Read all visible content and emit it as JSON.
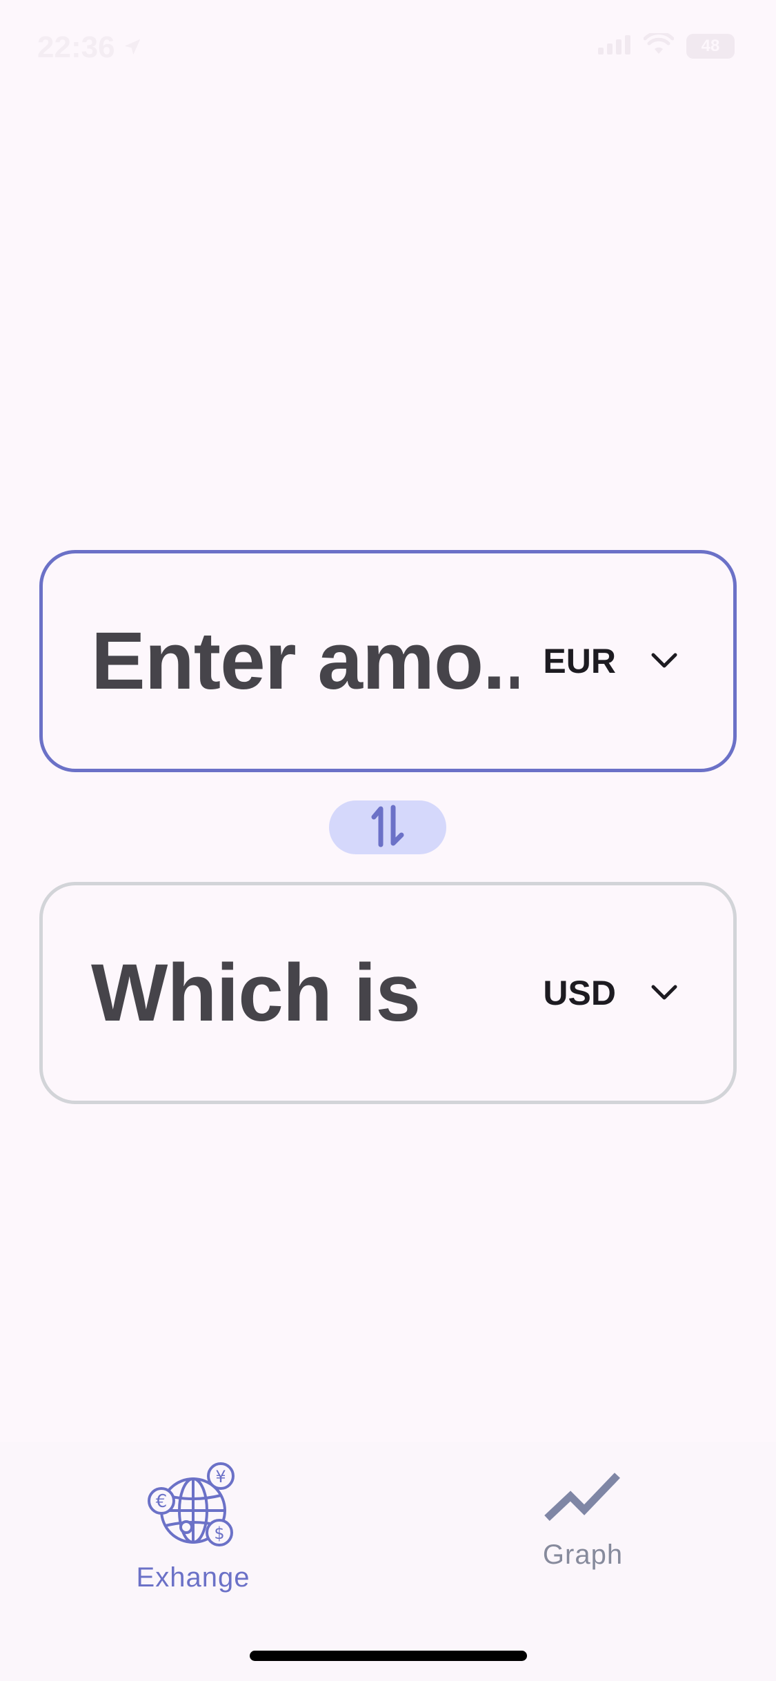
{
  "status_bar": {
    "time": "22:36",
    "battery": "48"
  },
  "converter": {
    "from": {
      "placeholder": "Enter amo...",
      "currency": "EUR"
    },
    "to": {
      "value": "Which is",
      "currency": "USD"
    }
  },
  "nav": {
    "items": [
      {
        "label": "Exhange",
        "icon": "globe-currency-icon",
        "active": true
      },
      {
        "label": "Graph",
        "icon": "graph-trend-icon",
        "active": false
      }
    ]
  },
  "colors": {
    "background": "#fdf7fc",
    "accent": "#6b71c7",
    "swap_bg": "#d5d8fb",
    "inactive_border": "#d2d4d8",
    "inactive_nav": "#868a9c"
  }
}
